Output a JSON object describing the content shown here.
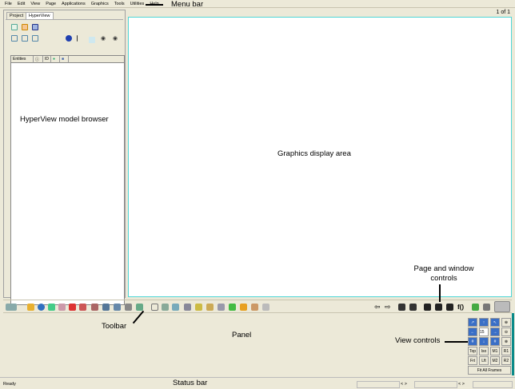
{
  "menu": [
    "File",
    "Edit",
    "View",
    "Page",
    "Applications",
    "Graphics",
    "Tools",
    "Utilities",
    "Help"
  ],
  "browser": {
    "tabs": [
      "Project",
      "HyperView"
    ],
    "active_tab": "HyperView",
    "columns": [
      "Entities",
      "",
      "ID",
      "",
      ""
    ]
  },
  "graphics": {
    "page_indicator": "1 of 1"
  },
  "toolbar": {
    "function_label": "f()"
  },
  "view_controls": {
    "zoom_value": "15",
    "buttons": [
      "Top",
      "Iso",
      "M1",
      "R1",
      "Frt",
      "Lft",
      "M2",
      "R2"
    ],
    "fit_all": "Fit All Frames"
  },
  "status": {
    "text": "Ready",
    "nav1": "< >",
    "nav2": "< >"
  },
  "annotations": {
    "menu_bar": "Menu bar",
    "browser": "HyperView model browser",
    "graphics": "Graphics display area",
    "page_window": "Page and window controls",
    "toolbar": "Toolbar",
    "panel": "Panel",
    "view_controls": "View controls",
    "status_bar": "Status bar"
  },
  "colors": {
    "background": "#ece9d8",
    "graphics_border": "#4fd6d6",
    "icon_blue": "#3a6fc6"
  }
}
